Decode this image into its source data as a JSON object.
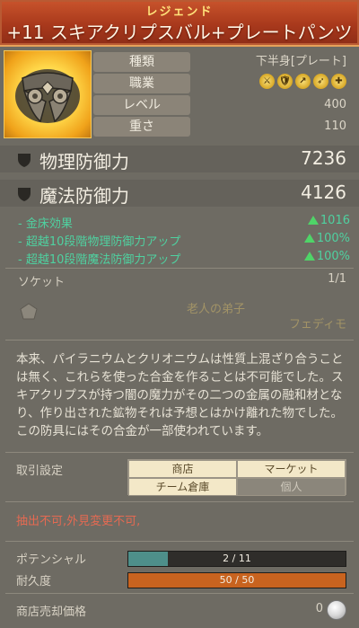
{
  "header": {
    "rarity": "レジェンド",
    "item_name": "+11 スキアクリプスバル+プレートパンツ"
  },
  "stats": [
    {
      "label": "種類",
      "value": "下半身[プレート]"
    },
    {
      "label": "職業",
      "value": ""
    },
    {
      "label": "レベル",
      "value": "400"
    },
    {
      "label": "重さ",
      "value": "110"
    }
  ],
  "class_icons": [
    "warrior-class-icon",
    "knight-class-icon",
    "scout-class-icon",
    "archer-class-icon",
    "healer-class-icon"
  ],
  "defense": {
    "physical": {
      "label": "物理防御力",
      "value": "7236"
    },
    "magic": {
      "label": "魔法防御力",
      "value": "4126"
    }
  },
  "bonuses": [
    {
      "label": "- 金床効果",
      "value": "1016"
    },
    {
      "label": "- 超越10段階物理防御力アップ",
      "value": "100%"
    },
    {
      "label": "- 超越10段階魔法防御力アップ",
      "value": "100%"
    }
  ],
  "socket": {
    "label": "ソケット",
    "count": "1/1"
  },
  "watermarks": {
    "line1": "老人の弟子",
    "line2": "フェディモ"
  },
  "description": "本来、パイラニウムとクリオニウムは性質上混ざり合うことは無く、これらを使った合金を作ることは不可能でした。スキアクリプスが持つ闇の魔力がその二つの金属の融和材となり、作り出された鉱物それは予想とはかけ離れた物でした。この防具にはその合金が一部使われています。",
  "trade": {
    "label": "取引設定",
    "options": [
      {
        "label": "商店",
        "enabled": true
      },
      {
        "label": "マーケット",
        "enabled": true
      },
      {
        "label": "チーム倉庫",
        "enabled": true
      },
      {
        "label": "個人",
        "enabled": false
      }
    ]
  },
  "restriction": "抽出不可,外見変更不可,",
  "potential": {
    "label": "ポテンシャル",
    "text": "2 / 11",
    "fraction": 0.18
  },
  "durability": {
    "label": "耐久度",
    "text": "50 / 50",
    "fraction": 1.0
  },
  "sell": {
    "label": "商店売却価格",
    "value": "0"
  },
  "colors": {
    "header": "#a9391c",
    "rarity_text": "#ffe27a",
    "bonus_text": "#4fd1a0",
    "restriction_text": "#e56a52",
    "potential_fill": "#4e8f8a",
    "durability_fill": "#c8631f"
  }
}
